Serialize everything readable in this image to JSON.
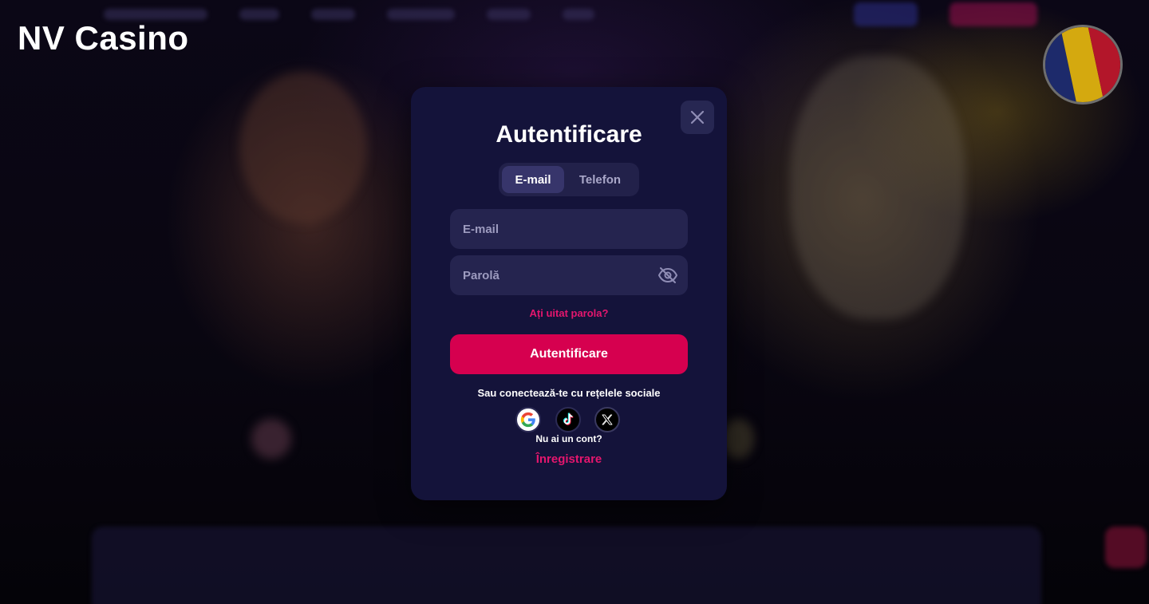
{
  "site": {
    "title": "NV Casino"
  },
  "language": {
    "flag_icon": "romania-flag-icon",
    "colors": [
      "#1d2a6b",
      "#d4a90f",
      "#b3162a"
    ]
  },
  "modal": {
    "title": "Autentificare",
    "close_icon": "close-icon",
    "tabs": [
      {
        "label": "E-mail",
        "active": true
      },
      {
        "label": "Telefon",
        "active": false
      }
    ],
    "email_placeholder": "E-mail",
    "password_placeholder": "Parolă",
    "password_toggle_icon": "eye-off-icon",
    "forgot_password": "Ați uitat parola?",
    "submit_label": "Autentificare",
    "social_text": "Sau conectează-te cu rețelele sociale",
    "socials": [
      "google-icon",
      "tiktok-icon",
      "x-icon"
    ],
    "no_account": "Nu ai un cont?",
    "register_label": "Înregistrare"
  },
  "colors": {
    "accent": "#d6004f",
    "link": "#e5166e",
    "modal_bg": "#14133a",
    "field_bg": "#25244f"
  }
}
